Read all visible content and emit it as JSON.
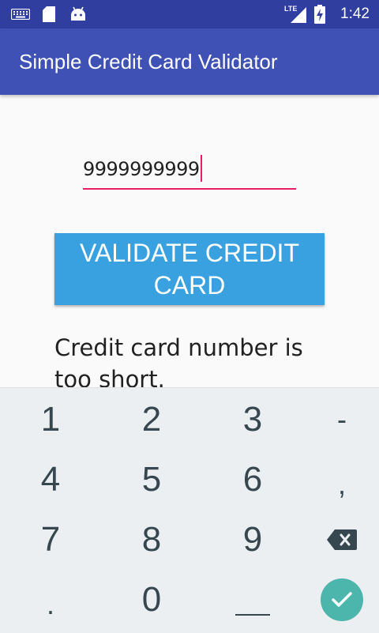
{
  "status_bar": {
    "time": "1:42",
    "icons": [
      "keyboard-icon",
      "sd-card-icon",
      "android-icon",
      "lte-signal-icon",
      "battery-charging-icon"
    ],
    "network": "LTE"
  },
  "app_bar": {
    "title": "Simple Credit Card Validator"
  },
  "form": {
    "card_number_value": "9999999999",
    "validate_button_label": "VALIDATE CREDIT CARD",
    "result_message": "Credit card number is too short."
  },
  "keyboard": {
    "rows": [
      [
        "1",
        "2",
        "3",
        "-"
      ],
      [
        "4",
        "5",
        "6",
        ","
      ],
      [
        "7",
        "8",
        "9",
        "backspace"
      ],
      [
        ".",
        "0",
        "space",
        "enter"
      ]
    ],
    "accent_color": "#4db6ac"
  },
  "colors": {
    "status_bar": "#303f9f",
    "app_bar": "#3f51b5",
    "input_accent": "#e91e63",
    "button": "#3aa1e0"
  }
}
